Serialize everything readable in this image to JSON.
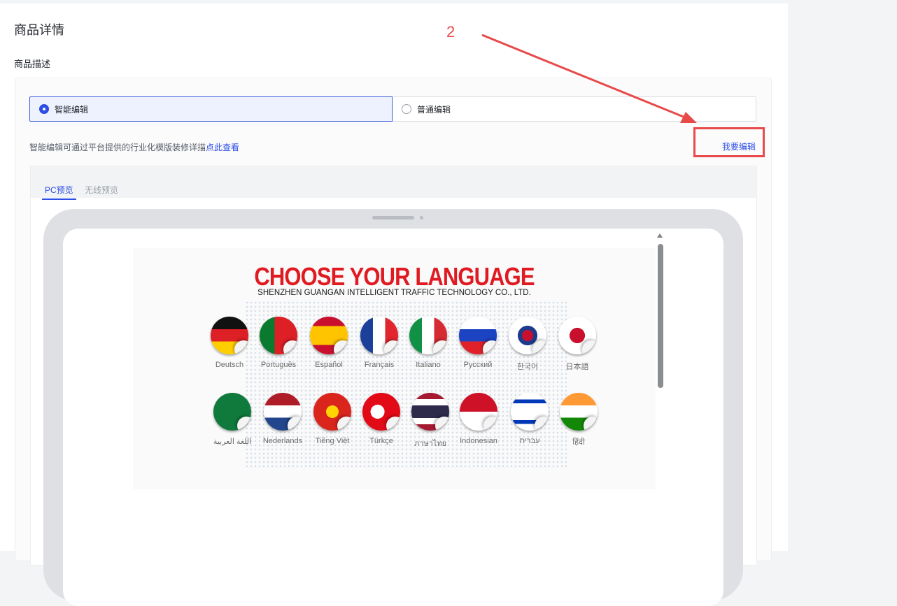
{
  "page": {
    "title": "商品详情",
    "section_title": "商品描述"
  },
  "edit_mode": {
    "options": [
      {
        "label": "智能编辑",
        "selected": true
      },
      {
        "label": "普通编辑",
        "selected": false
      }
    ],
    "hint_text": "智能编辑可通过平台提供的行业化模版装修详描",
    "hint_link": "点此查看",
    "edit_link": "我要编辑"
  },
  "preview": {
    "tabs": [
      {
        "label": "PC预览",
        "active": true
      },
      {
        "label": "无线预览",
        "active": false
      }
    ],
    "banner": {
      "title": "CHOOSE YOUR LANGUAGE",
      "subtitle": "SHENZHEN GUANGAN INTELLIGENT TRAFFIC TECHNOLOGY CO., LTD.",
      "languages_row1": [
        "Deutsch",
        "Português",
        "Español",
        "Français",
        "Italiano",
        "Русский",
        "한국어",
        "日本語"
      ],
      "languages_row2": [
        "اللغة العربية",
        "Nederlands",
        "Tiếng Việt",
        "Türkçe",
        "ภาษาไทย",
        "Indonesian",
        "עברית",
        "हिंदी"
      ]
    }
  },
  "annotation": {
    "number": "2",
    "color": "#e84a4a"
  },
  "colors": {
    "accent": "#2c4de6",
    "banner_title": "#e11a22"
  }
}
